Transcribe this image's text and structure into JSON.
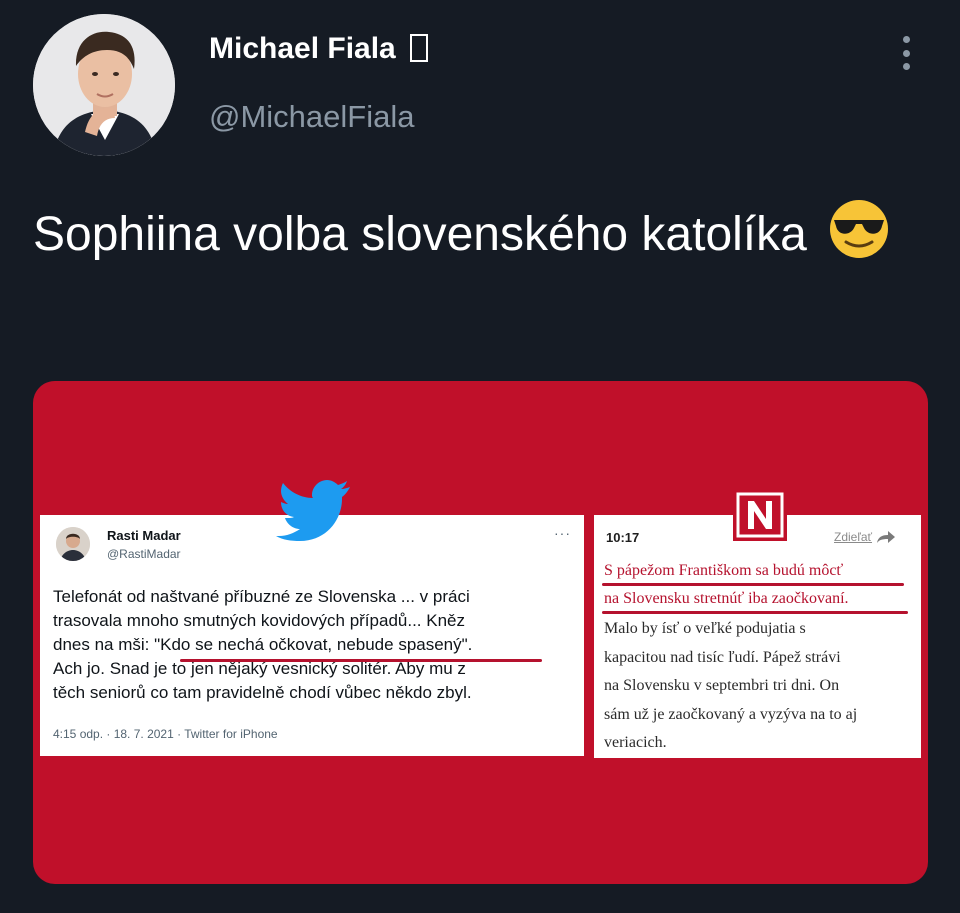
{
  "author": {
    "name": "Michael Fiala",
    "badge": " ",
    "handle": "@MichaelFiala",
    "more_icon": "vertical-ellipsis-icon"
  },
  "tweet": {
    "text": "Sophiina volba slovenského katolíka",
    "emoji": "😎"
  },
  "media": {
    "background": "#c0102a",
    "embedded_tweet": {
      "name": "Rasti Madar",
      "handle": "@RastiMadar",
      "dots": "···",
      "body_lines": [
        "Telefonát od naštvané příbuzné ze Slovenska ... v práci",
        "trasovala mnoho smutných kovidových případů... Kněz",
        "dnes na mši: \"Kdo se nechá očkovat, nebude spasený\".",
        "Ach jo. Snad je to jen nějaký vesnický solitér. Aby mu z",
        "těch seniorů co tam pravidelně chodí vůbec někdo zbyl."
      ],
      "meta": "4:15 odp. · 18. 7. 2021 · Twitter for iPhone"
    },
    "news_card": {
      "time": "10:17",
      "share_label": "Zdieľať",
      "headline_lines": [
        "S pápežom Františkom sa budú môcť",
        "na Slovensku stretnúť iba zaočkovaní."
      ],
      "body_lines": [
        "Malo by ísť o veľké podujatia s",
        "kapacitou nad tisíc ľudí. Pápež strávi",
        "na Slovensku v septembri tri dni. On",
        "sám už je zaočkovaný a vyzýva na to aj",
        "veriacich."
      ]
    }
  }
}
